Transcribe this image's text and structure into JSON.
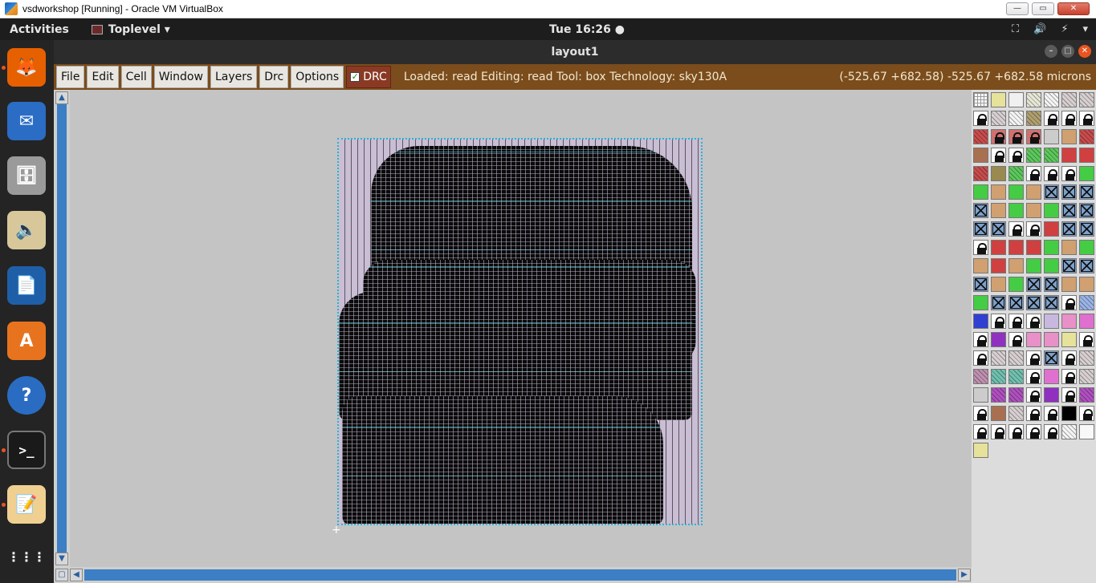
{
  "host_window": {
    "title": "vsdworkshop [Running] - Oracle VM VirtualBox",
    "minimize_label": "—",
    "restore_label": "▭",
    "close_label": "✕"
  },
  "gnome": {
    "activities_label": "Activities",
    "app_menu_label": "Toplevel ▾",
    "clock": "Tue 16:26 ●",
    "tray": [
      "⛶",
      "🔊",
      "⚡",
      "▾"
    ]
  },
  "dock": {
    "items": [
      {
        "name": "firefox-icon",
        "glyph": "🦊",
        "active": true
      },
      {
        "name": "thunderbird-icon",
        "glyph": "✉",
        "active": false
      },
      {
        "name": "files-icon",
        "glyph": "🗄",
        "active": false
      },
      {
        "name": "rhythmbox-icon",
        "glyph": "🔈",
        "active": false
      },
      {
        "name": "writer-icon",
        "glyph": "📄",
        "active": false
      },
      {
        "name": "software-icon",
        "glyph": "A",
        "active": false
      },
      {
        "name": "help-icon",
        "glyph": "?",
        "active": false
      },
      {
        "name": "terminal-icon",
        "glyph": ">_",
        "active": true
      },
      {
        "name": "text-editor-icon",
        "glyph": "📝",
        "active": true
      },
      {
        "name": "app-grid-icon",
        "glyph": "⋮⋮⋮",
        "active": false
      }
    ]
  },
  "magic_window": {
    "title": "layout1",
    "menus": [
      "File",
      "Edit",
      "Cell",
      "Window",
      "Layers",
      "Drc",
      "Options"
    ],
    "drc_label": "DRC",
    "status": "Loaded: read Editing: read Tool: box  Technology: sky130A",
    "coords": "(-525.67 +682.58) -525.67 +682.58 microns"
  },
  "palette_rows": [
    [
      "grid",
      "yellow",
      "white-box",
      "light-hatch",
      "hatch",
      "gray-hatch",
      "gray-hatch"
    ],
    [
      "lock",
      "gray-hatch",
      "hatch",
      "tan-hatch",
      "lock",
      "lock",
      "lock"
    ],
    [
      "red-hatch",
      "lock-red",
      "lock-red",
      "lock-red",
      "gray",
      "tan",
      "red-hatch"
    ],
    [
      "brown",
      "lock",
      "lock",
      "green-hatch",
      "green-hatch",
      "red",
      "red"
    ],
    [
      "red-hatch",
      "olive",
      "green-hatch",
      "lock",
      "lock",
      "lock",
      "green"
    ],
    [
      "green",
      "tan",
      "green",
      "tan",
      "xbox",
      "xbox",
      "xbox"
    ],
    [
      "xbox",
      "tan",
      "green",
      "tan",
      "green",
      "xbox",
      "xbox"
    ],
    [
      "xbox",
      "xbox",
      "lock",
      "lock",
      "red",
      "xbox",
      "xbox"
    ],
    [
      "lock",
      "red",
      "red",
      "red",
      "green",
      "tan",
      "green"
    ],
    [
      "tan",
      "red",
      "tan",
      "green",
      "green",
      "xbox",
      "xbox"
    ],
    [
      "xbox",
      "tan",
      "green",
      "xbox",
      "xbox",
      "tan",
      "tan"
    ],
    [
      "green",
      "xbox",
      "xbox",
      "xbox",
      "xbox",
      "lock",
      "blue-hatch"
    ],
    [
      "blue",
      "lock",
      "lock",
      "lock",
      "lavender",
      "pink",
      "magenta"
    ],
    [
      "lock",
      "purple",
      "lock",
      "pink",
      "pink",
      "yellow",
      "lock"
    ],
    [
      "lock",
      "gray-hatch",
      "gray-hatch",
      "lock",
      "xbox",
      "lock",
      "gray-hatch"
    ],
    [
      "pink-hatch",
      "teal-hatch",
      "teal-hatch",
      "lock",
      "magenta",
      "lock",
      "gray-hatch"
    ],
    [
      "gray",
      "purple-hatch",
      "purple-hatch",
      "lock",
      "purple",
      "lock",
      "purple-hatch"
    ],
    [
      "lock",
      "brown",
      "gray-hatch",
      "lock",
      "lock",
      "black",
      "lock"
    ],
    [
      "lock",
      "lock",
      "lock",
      "lock",
      "lock",
      "hatch",
      "white"
    ],
    [
      "yellow"
    ]
  ],
  "colors": {
    "menubar": "#7b4d1c",
    "canvas": "#c4c4c4",
    "chip_bg": "#c9bed4",
    "grid_lines": "#25b8c8",
    "scrollbar": "#3c7fc4"
  }
}
